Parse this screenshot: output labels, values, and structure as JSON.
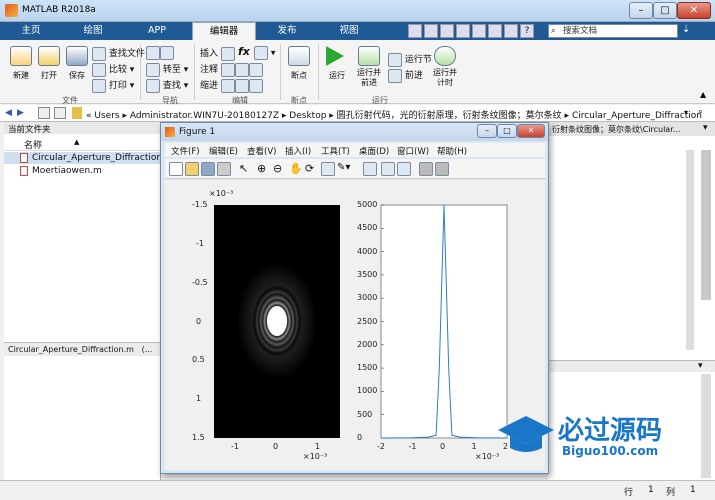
{
  "window": {
    "title": "MATLAB R2018a"
  },
  "quick_access": {
    "search_placeholder": "搜索文档"
  },
  "tabs": [
    {
      "label": "主页"
    },
    {
      "label": "绘图"
    },
    {
      "label": "APP"
    },
    {
      "label": "编辑器"
    },
    {
      "label": "发布"
    },
    {
      "label": "视图"
    }
  ],
  "ribbon": {
    "file": {
      "new": "新建",
      "open": "打开",
      "save": "保存",
      "find_files": "查找文件",
      "compare": "比较",
      "print": "打印",
      "group": "文件"
    },
    "navigate": {
      "goto": "转至",
      "find": "查找",
      "group": "导航"
    },
    "edit": {
      "insert": "插入",
      "comment": "注释",
      "indent": "缩进",
      "fx": "fx",
      "group": "编辑"
    },
    "breakpoints": {
      "label": "断点",
      "group": "断点"
    },
    "run": {
      "run": "运行",
      "run_advance": "运行并\n前进",
      "run_section": "运行节",
      "advance": "前进",
      "run_time": "运行并\n计时",
      "group": "运行"
    }
  },
  "address": {
    "path": [
      "Users",
      "Administrator.WIN7U-20180127Z",
      "Desktop",
      "圆孔衍射代码，光的衍射原理，衍射条纹图像；莫尔条纹",
      "Circular_Aperture_Diffraction"
    ]
  },
  "current_folder": {
    "title": "当前文件夹",
    "column": "名称",
    "files": [
      "Circular_Aperture_Diffraction.m",
      "Moertiaowen.m"
    ],
    "details": "Circular_Aperture_Diffraction.m   (..."
  },
  "right_panel": {
    "tab": "衍射条纹图像；莫尔条纹\\Circular..."
  },
  "figure": {
    "title": "Figure 1",
    "menu": [
      "文件(F)",
      "编辑(E)",
      "查看(V)",
      "插入(I)",
      "工具(T)",
      "桌面(D)",
      "窗口(W)",
      "帮助(H)"
    ],
    "left_plot": {
      "exponent_top": "×10⁻³",
      "exponent_bottom": "×10⁻³",
      "y_ticks": [
        "-1.5",
        "-1",
        "-0.5",
        "0",
        "0.5",
        "1",
        "1.5"
      ],
      "x_ticks": [
        "-1",
        "0",
        "1"
      ]
    },
    "right_plot": {
      "exponent_bottom": "×10⁻³",
      "y_ticks": [
        "5000",
        "4500",
        "4000",
        "3500",
        "3000",
        "2500",
        "2000",
        "1500",
        "1000",
        "500",
        "0"
      ],
      "x_ticks": [
        "-2",
        "-1",
        "0",
        "1",
        "2"
      ]
    }
  },
  "chart_data": [
    {
      "type": "heatmap",
      "title": "",
      "xlim": [
        -1.5,
        1.5
      ],
      "ylim": [
        -1.5,
        1.5
      ],
      "x_scale": "×10^-3",
      "y_scale": "×10^-3",
      "description_values": "Airy diffraction rings, bright center at (0,0)"
    },
    {
      "type": "line",
      "xlim": [
        -2,
        2
      ],
      "ylim": [
        0,
        5000
      ],
      "x_scale": "×10^-3",
      "series": [
        {
          "values_x": [
            -2,
            -1,
            -0.5,
            -0.25,
            -0.15,
            0,
            0.15,
            0.25,
            0.5,
            1,
            2
          ],
          "values_y": [
            0,
            5,
            20,
            60,
            1500,
            5000,
            1500,
            60,
            20,
            5,
            0
          ]
        }
      ]
    }
  ],
  "status": {
    "row_label": "行",
    "row": "1",
    "col_label": "列",
    "col": "1"
  },
  "watermark": {
    "text": "必过源码",
    "url": "Biguo100.com"
  }
}
